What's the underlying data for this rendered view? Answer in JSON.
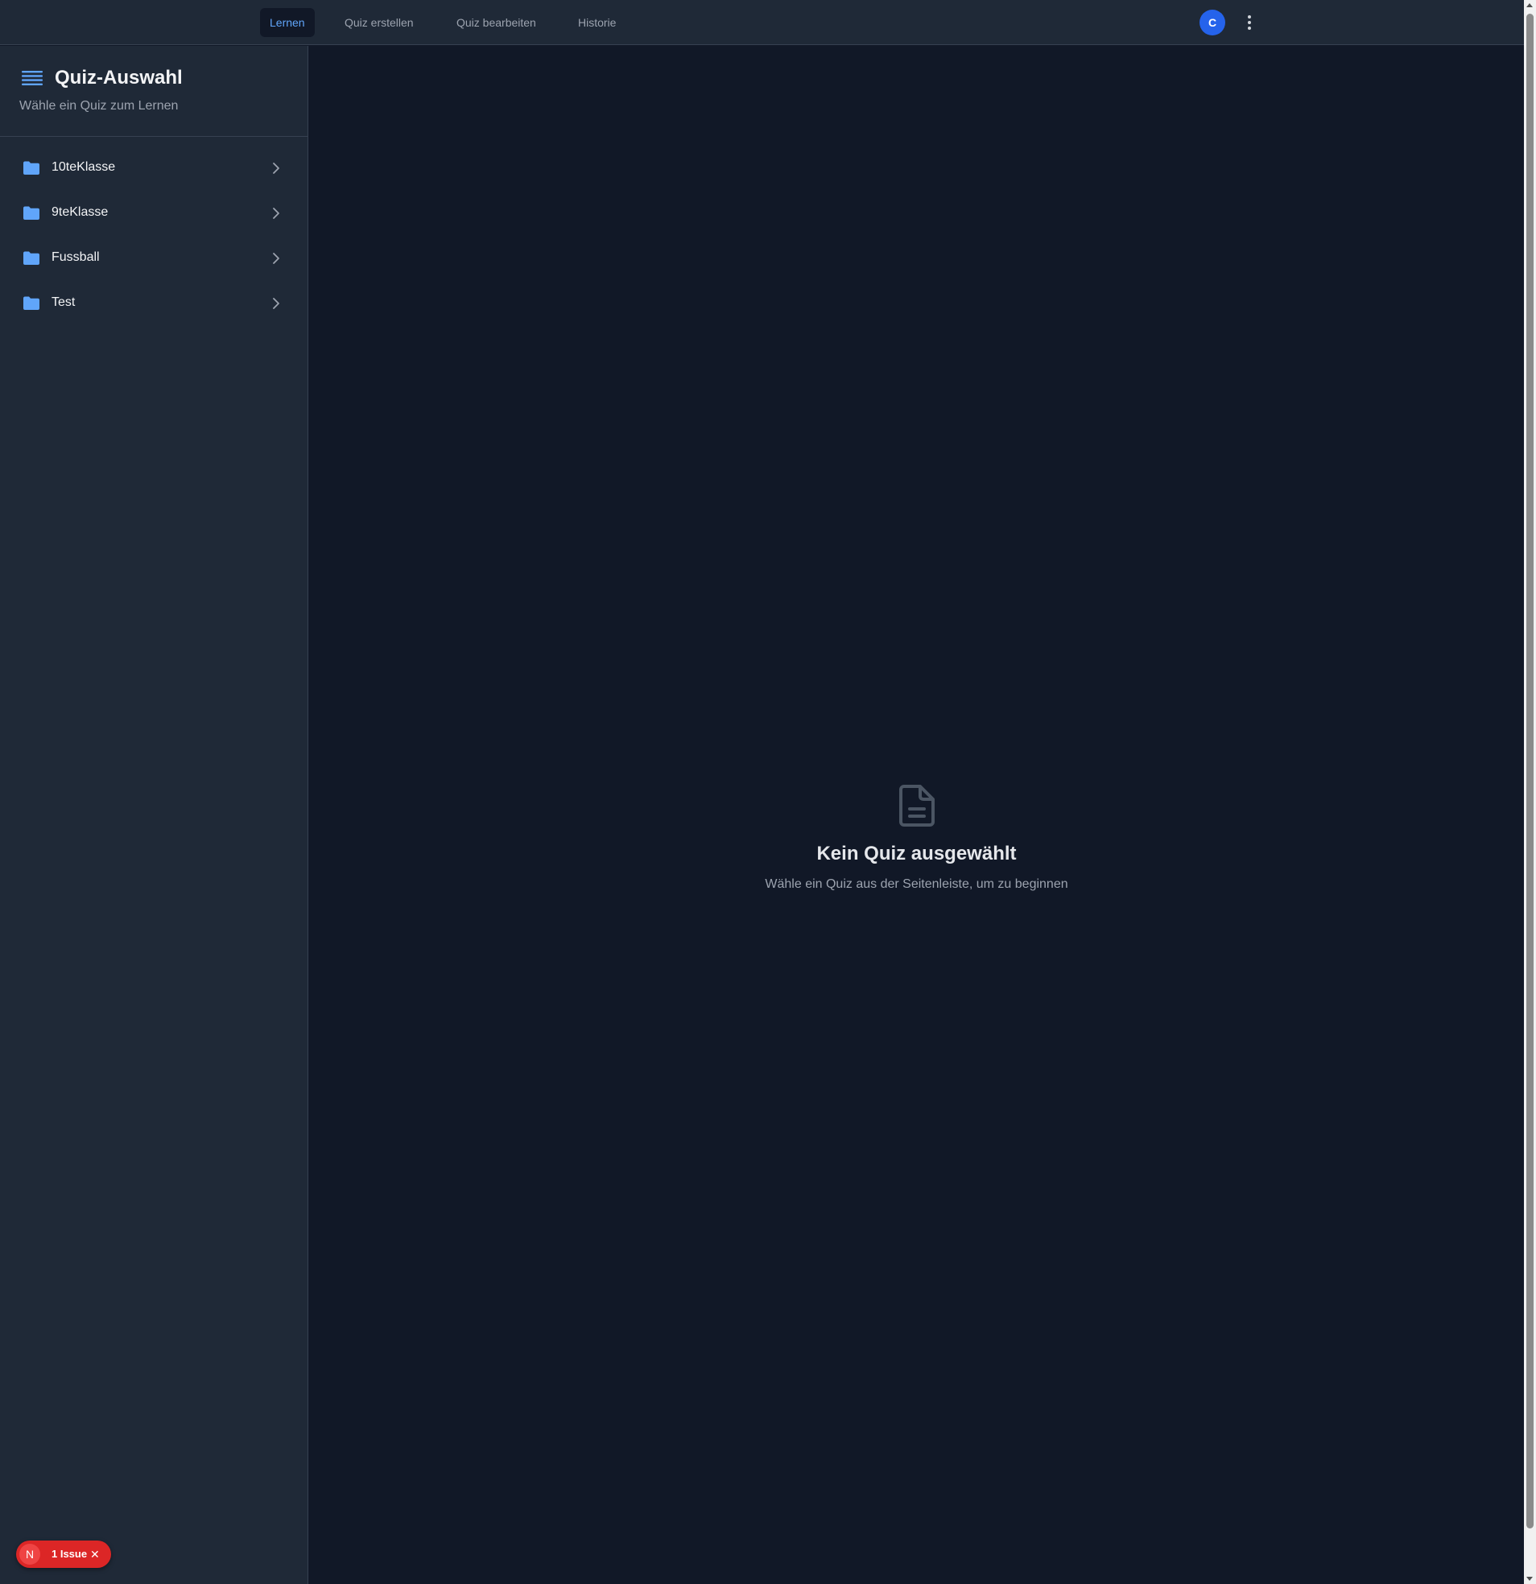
{
  "nav": {
    "tabs": [
      {
        "label": "Lernen",
        "active": true
      },
      {
        "label": "Quiz erstellen",
        "active": false
      },
      {
        "label": "Quiz bearbeiten",
        "active": false
      },
      {
        "label": "Historie",
        "active": false
      }
    ],
    "avatar_initial": "C",
    "more_icon": "kebab-vertical-icon"
  },
  "sidebar": {
    "title": "Quiz-Auswahl",
    "title_icon": "menu-lines-icon",
    "subtitle": "Wähle ein Quiz zum Lernen",
    "folders": [
      {
        "label": "10teKlasse",
        "icon": "folder-icon"
      },
      {
        "label": "9teKlasse",
        "icon": "folder-icon"
      },
      {
        "label": "Fussball",
        "icon": "folder-icon"
      },
      {
        "label": "Test",
        "icon": "folder-icon"
      }
    ]
  },
  "main": {
    "empty_icon": "document-icon",
    "empty_title": "Kein Quiz ausgewählt",
    "empty_text": "Wähle ein Quiz aus der Seitenleiste, um zu beginnen"
  },
  "issue_badge": {
    "logo": "N",
    "label": "1 Issue",
    "close": "✕"
  },
  "colors": {
    "background": "#111827",
    "panel": "#1f2937",
    "accent": "#60a5fa",
    "avatar": "#2563eb",
    "issue": "#dc2626"
  }
}
